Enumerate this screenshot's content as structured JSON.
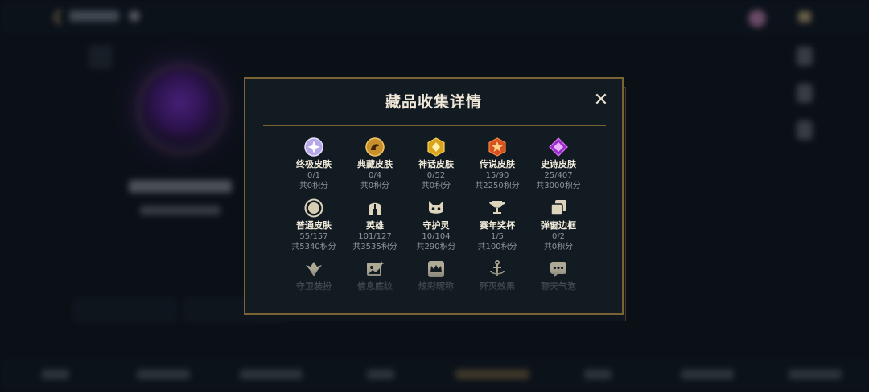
{
  "modal": {
    "title": "藏品收集详情",
    "close_label": "✕"
  },
  "categories": [
    {
      "label": "终极皮肤",
      "count": "0/1",
      "points": "共0积分",
      "icon": "ultimate-skin-icon"
    },
    {
      "label": "典藏皮肤",
      "count": "0/4",
      "points": "共0积分",
      "icon": "prestige-skin-icon"
    },
    {
      "label": "神话皮肤",
      "count": "0/52",
      "points": "共0积分",
      "icon": "mythic-skin-icon"
    },
    {
      "label": "传说皮肤",
      "count": "15/90",
      "points": "共2250积分",
      "icon": "legendary-skin-icon"
    },
    {
      "label": "史诗皮肤",
      "count": "25/407",
      "points": "共3000积分",
      "icon": "epic-skin-icon"
    },
    {
      "label": "普通皮肤",
      "count": "55/157",
      "points": "共5340积分",
      "icon": "standard-skin-icon"
    },
    {
      "label": "英雄",
      "count": "101/127",
      "points": "共3535积分",
      "icon": "champion-helmet-icon"
    },
    {
      "label": "守护灵",
      "count": "10/104",
      "points": "共290积分",
      "icon": "companion-icon"
    },
    {
      "label": "赛年奖杯",
      "count": "1/5",
      "points": "共100积分",
      "icon": "trophy-icon"
    },
    {
      "label": "弹窗边框",
      "count": "0/2",
      "points": "共0积分",
      "icon": "frame-icon"
    },
    {
      "label": "守卫装扮",
      "icon": "ward-skin-icon"
    },
    {
      "label": "信息底纹",
      "icon": "banner-icon"
    },
    {
      "label": "炫彩昵称",
      "icon": "crown-name-icon"
    },
    {
      "label": "歼灭效果",
      "icon": "finisher-anchor-icon"
    },
    {
      "label": "聊天气泡",
      "icon": "chat-bubble-icon"
    }
  ],
  "colors": {
    "accent_gold": "#7a6435",
    "title_text": "#efe8d8",
    "muted_text": "#8e959c"
  }
}
